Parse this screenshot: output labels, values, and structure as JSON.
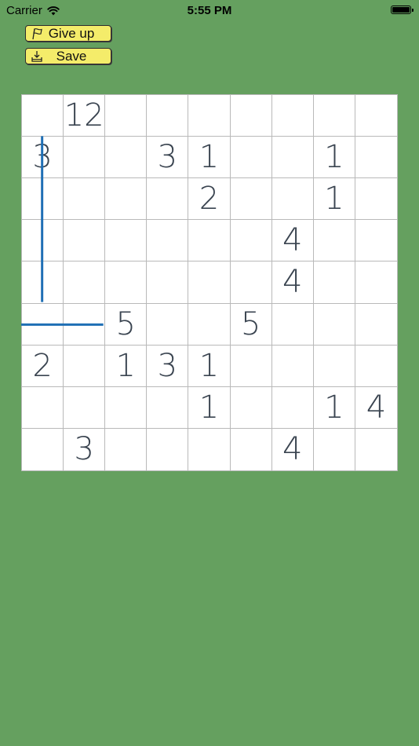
{
  "status_bar": {
    "carrier": "Carrier",
    "time": "5:55 PM",
    "icons": [
      "wifi-icon",
      "battery-icon"
    ]
  },
  "toolbar": {
    "give_up_label": "Give up",
    "give_up_icon": "flag-icon",
    "save_label": "Save",
    "save_icon": "save-tray-icon"
  },
  "colors": {
    "background": "#65a05f",
    "button": "#f4ec6a",
    "grid_line": "#b9b9b9",
    "number": "#3a4450",
    "drawn_line": "#1f6fb5"
  },
  "board": {
    "rows": 9,
    "cols": 9,
    "cells": [
      [
        "",
        "12",
        "",
        "",
        "",
        "",
        "",
        "",
        ""
      ],
      [
        "3",
        "",
        "",
        "3",
        "1",
        "",
        "",
        "1",
        ""
      ],
      [
        "",
        "",
        "",
        "",
        "2",
        "",
        "",
        "1",
        ""
      ],
      [
        "",
        "",
        "",
        "",
        "",
        "",
        "4",
        "",
        ""
      ],
      [
        "",
        "",
        "",
        "",
        "",
        "",
        "4",
        "",
        ""
      ],
      [
        "",
        "",
        "5",
        "",
        "",
        "5",
        "",
        "",
        ""
      ],
      [
        "2",
        "",
        "1",
        "3",
        "1",
        "",
        "",
        "",
        ""
      ],
      [
        "",
        "",
        "",
        "",
        "1",
        "",
        "",
        "1",
        "4"
      ],
      [
        "",
        "3",
        "",
        "",
        "",
        "",
        "4",
        "",
        ""
      ]
    ],
    "drawn_lines": [
      {
        "from": [
          1,
          0
        ],
        "to": [
          4,
          0
        ]
      },
      {
        "from": [
          5,
          0
        ],
        "to": [
          5,
          1
        ]
      }
    ]
  }
}
